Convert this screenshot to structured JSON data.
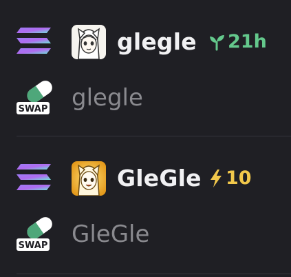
{
  "entries": [
    {
      "chain_icon": "solana-icon",
      "avatar_icon": "anime-girl-avatar-bw",
      "name": "glegle",
      "badge": {
        "icon": "sprout-icon",
        "text": "21h",
        "color": "#64c88c"
      },
      "swap": {
        "icon": "swap-pill-icon",
        "label": "SWAP",
        "name": "glegle"
      }
    },
    {
      "chain_icon": "solana-icon",
      "avatar_icon": "anime-girl-avatar-gold",
      "name": "GleGle",
      "badge": {
        "icon": "lightning-icon",
        "text": "10",
        "color": "#f2c84b"
      },
      "swap": {
        "icon": "swap-pill-icon",
        "label": "SWAP",
        "name": "GleGle"
      }
    }
  ]
}
